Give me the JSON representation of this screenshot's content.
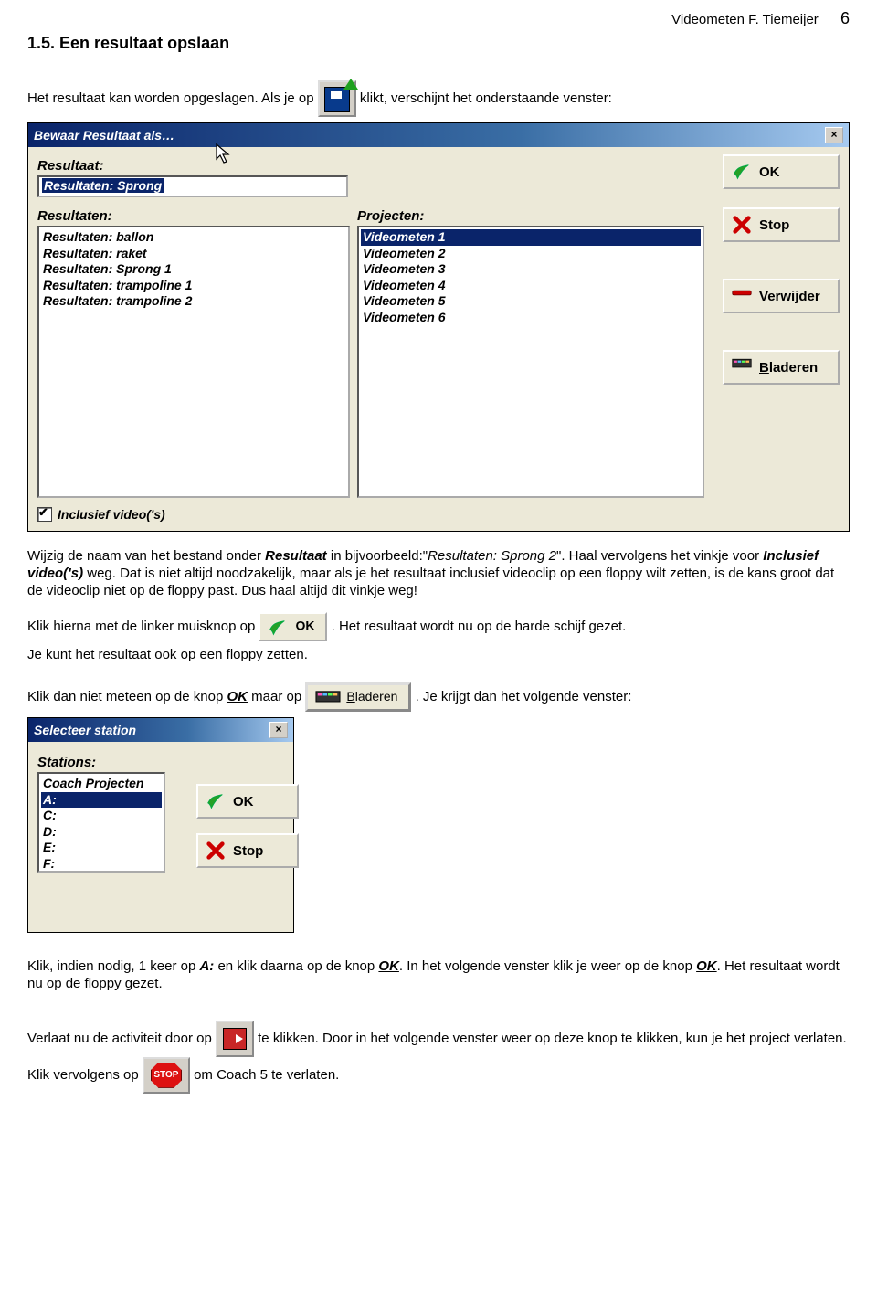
{
  "header": {
    "doc_title": "Videometen F. Tiemeijer",
    "page_number": "6"
  },
  "section_title": "1.5. Een resultaat opslaan",
  "p1_a": "Het resultaat kan worden opgeslagen. Als je op ",
  "p1_b": " klikt, verschijnt het onderstaande venster:",
  "dlg1": {
    "title": "Bewaar Resultaat als…",
    "label_resultaat": "Resultaat:",
    "input_value": "Resultaten: Sprong",
    "label_resultaten": "Resultaten:",
    "label_projecten": "Projecten:",
    "resultaten_items": [
      "Resultaten: ballon",
      "Resultaten: raket",
      "Resultaten: Sprong 1",
      "Resultaten: trampoline 1",
      "Resultaten: trampoline 2"
    ],
    "projecten_items": [
      "Videometen 1",
      "Videometen 2",
      "Videometen 3",
      "Videometen 4",
      "Videometen 5",
      "Videometen 6"
    ],
    "btn_ok": "OK",
    "btn_stop": "Stop",
    "btn_verwijder": "Verwijder",
    "btn_bladeren": "Bladeren",
    "checkbox_label": "Inclusief video('s)"
  },
  "p2_a": "Wijzig de naam van het bestand onder ",
  "p2_b": "Resultaat",
  "p2_c": "  in bijvoorbeeld:\"",
  "p2_d": "Resultaten: Sprong 2",
  "p2_e": "\". Haal vervolgens het vinkje voor ",
  "p2_f": "Inclusief video('s)",
  "p2_g": " weg. Dat is niet altijd noodzakelijk, maar als je het resultaat inclusief videoclip op een floppy wilt zetten, is de kans groot dat de videoclip niet op de floppy past. Dus haal altijd dit vinkje weg!",
  "p3_a": "Klik hierna met de linker muisknop op ",
  "p3_b": ". Het resultaat wordt nu op de harde schijf gezet.",
  "ok_inline_label": "OK",
  "p4": "Je kunt het resultaat ook op een floppy zetten.",
  "p5_a": "Klik dan niet meteen op de knop ",
  "p5_ok": "OK",
  "p5_b": " maar op ",
  "bladeren_inline_label": "Bladeren",
  "p5_c": ". Je krijgt dan het volgende venster:",
  "dlg2": {
    "title": "Selecteer station",
    "label_stations": "Stations:",
    "stations_items": [
      "Coach Projecten",
      "A:",
      "C:",
      "D:",
      "E:",
      "F:"
    ],
    "btn_ok": "OK",
    "btn_stop": "Stop"
  },
  "p6_a": "Klik, indien nodig, 1 keer op ",
  "p6_b": "A:",
  "p6_c": " en klik daarna op de knop ",
  "p6_ok": "OK",
  "p6_d": ". In het volgende venster klik je weer op de knop ",
  "p6_ok2": "OK",
  "p6_e": ". Het resultaat wordt nu op de floppy gezet.",
  "p7_a": "Verlaat nu de activiteit door op ",
  "p7_b": " te klikken. Door in het volgende venster weer op deze knop te klikken, kun je het project verlaten. Klik vervolgens op ",
  "p7_c": " om Coach 5 te verlaten.",
  "stop_label": "STOP"
}
